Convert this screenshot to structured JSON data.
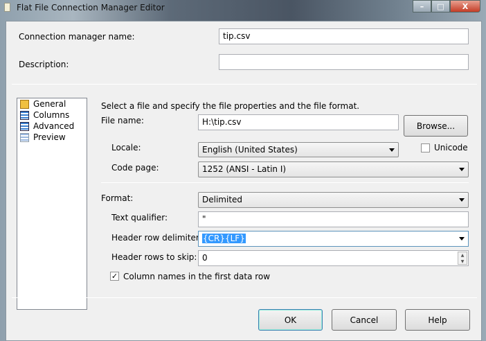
{
  "window": {
    "title": "Flat File Connection Manager Editor",
    "minimize": "–",
    "maximize": "□",
    "close": "X"
  },
  "connection_manager_name": {
    "label": "Connection manager name:",
    "value": "tip.csv"
  },
  "description": {
    "label": "Description:",
    "value": ""
  },
  "nav": {
    "items": [
      {
        "label": "General",
        "icon": "general-icon"
      },
      {
        "label": "Columns",
        "icon": "columns-icon"
      },
      {
        "label": "Advanced",
        "icon": "advanced-icon"
      },
      {
        "label": "Preview",
        "icon": "preview-icon"
      }
    ]
  },
  "general": {
    "instruction": "Select a file and specify the file properties and the file format.",
    "file_name": {
      "label": "File name:",
      "value": "H:\\tip.csv"
    },
    "browse": "Browse...",
    "locale": {
      "label": "Locale:",
      "value": "English (United States)"
    },
    "unicode": {
      "label": "Unicode",
      "checked": false
    },
    "code_page": {
      "label": "Code page:",
      "value": "1252  (ANSI - Latin I)"
    },
    "format": {
      "label": "Format:",
      "value": "Delimited"
    },
    "text_qualifier": {
      "label": "Text qualifier:",
      "value": "\""
    },
    "header_row_delimiter": {
      "label": "Header row delimiter:",
      "value": "{CR}{LF}"
    },
    "header_rows_to_skip": {
      "label": "Header rows to skip:",
      "value": "0"
    },
    "column_names": {
      "label": "Column names in the first data row",
      "checked": true,
      "mark": "✓"
    }
  },
  "buttons": {
    "ok": "OK",
    "cancel": "Cancel",
    "help": "Help"
  }
}
